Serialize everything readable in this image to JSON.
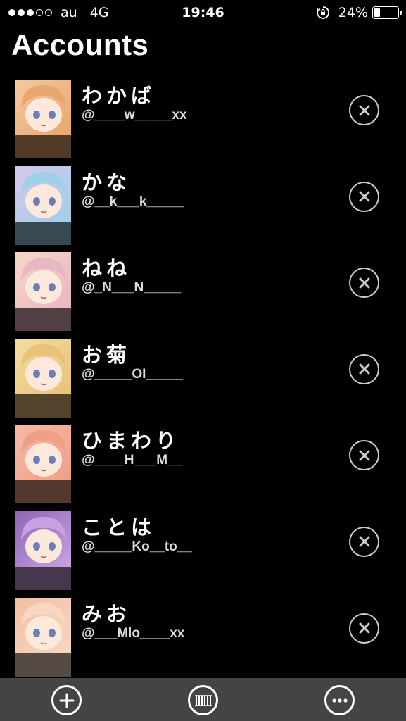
{
  "status_bar": {
    "carrier": "au",
    "network": "4G",
    "time": "19:46",
    "battery_percent": "24%",
    "signal_bars_filled": 3,
    "signal_bars_total": 5,
    "battery_level": 0.24
  },
  "page": {
    "title": "Accounts"
  },
  "accounts": [
    {
      "name": "わかば",
      "handle": "@____w_____xx",
      "avatar_colors": [
        "#f4c9a0",
        "#e9a66e"
      ]
    },
    {
      "name": "かな",
      "handle": "@__k___k_____",
      "avatar_colors": [
        "#d7c6ec",
        "#9fd0ea"
      ]
    },
    {
      "name": "ねね",
      "handle": "@_N___N_____",
      "avatar_colors": [
        "#f7d7c6",
        "#e8b6c4"
      ]
    },
    {
      "name": "お菊",
      "handle": "@_____OI_____",
      "avatar_colors": [
        "#f3dca0",
        "#e9c27a"
      ]
    },
    {
      "name": "ひまわり",
      "handle": "@____H___M__",
      "avatar_colors": [
        "#f6b9a8",
        "#f09f86"
      ]
    },
    {
      "name": "ことは",
      "handle": "@_____Ko__to__",
      "avatar_colors": [
        "#8f64b8",
        "#c7a2e0"
      ]
    },
    {
      "name": "みお",
      "handle": "@___Mlo____xx",
      "avatar_colors": [
        "#f4bfa2",
        "#f7d7c2"
      ]
    }
  ],
  "toolbar": {
    "add_icon": "plus-circle-icon",
    "middle_icon": "barcode-circle-icon",
    "more_icon": "ellipsis-circle-icon"
  },
  "icons": {
    "remove": "close-circle-icon"
  }
}
